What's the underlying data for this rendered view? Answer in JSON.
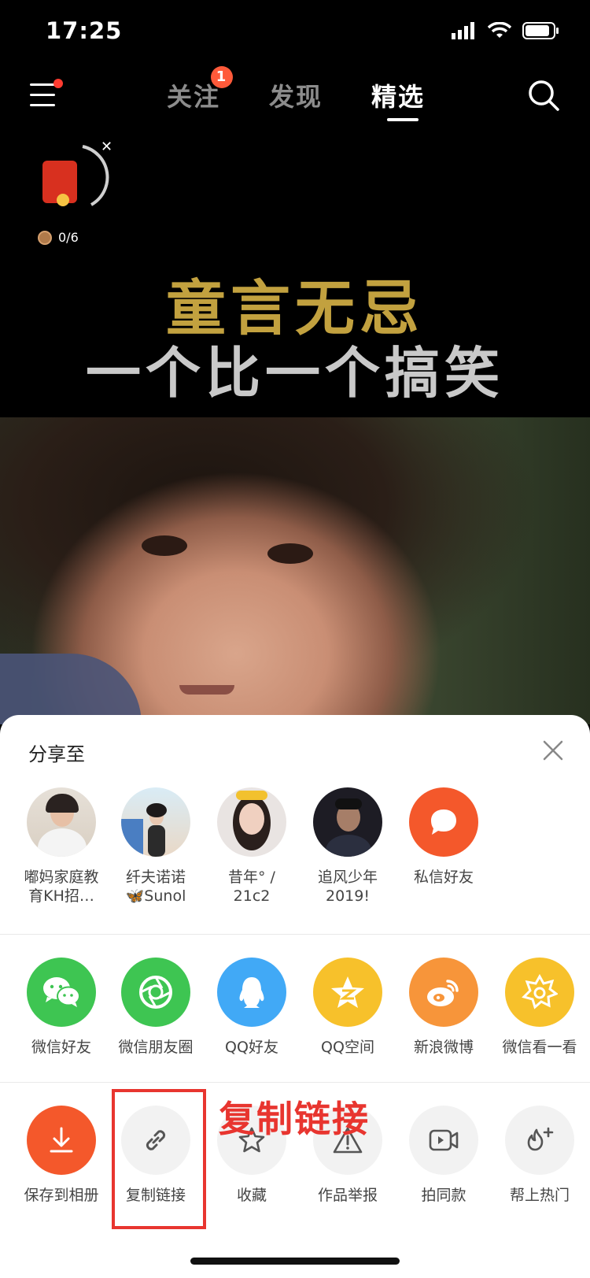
{
  "status_bar": {
    "time": "17:25"
  },
  "top_nav": {
    "tabs": [
      {
        "label": "关注",
        "badge": "1"
      },
      {
        "label": "发现"
      },
      {
        "label": "精选",
        "active": true
      }
    ]
  },
  "red_packet": {
    "progress_text": "0/6"
  },
  "video": {
    "caption_line1": "童言无忌",
    "caption_line2": "一个比一个搞笑"
  },
  "share_sheet": {
    "title": "分享至",
    "contacts": [
      {
        "name_line1": "嘟妈家庭教",
        "name_line2": "育KH招…"
      },
      {
        "name_line1": "纤夫诺诺",
        "name_line2": "🦋Sunol"
      },
      {
        "name_line1": "昔年° /",
        "name_line2": "21c2"
      },
      {
        "name_line1": "追风少年",
        "name_line2": "2019!"
      },
      {
        "name_line1": "私信好友",
        "name_line2": ""
      }
    ],
    "platforms": [
      {
        "label": "微信好友",
        "color": "#3ec552",
        "icon": "wechat-icon"
      },
      {
        "label": "微信朋友圈",
        "color": "#3ec552",
        "icon": "moments-icon"
      },
      {
        "label": "QQ好友",
        "color": "#41a9f6",
        "icon": "qq-icon"
      },
      {
        "label": "QQ空间",
        "color": "#f7c12b",
        "icon": "qzone-icon"
      },
      {
        "label": "新浪微博",
        "color": "#f7953a",
        "icon": "weibo-icon"
      },
      {
        "label": "微信看一看",
        "color": "#f7c12b",
        "icon": "wechat-look-icon"
      }
    ],
    "actions": [
      {
        "label": "保存到相册",
        "icon": "download-icon"
      },
      {
        "label": "复制链接",
        "icon": "link-icon"
      },
      {
        "label": "收藏",
        "icon": "star-icon"
      },
      {
        "label": "作品举报",
        "icon": "warning-icon"
      },
      {
        "label": "拍同款",
        "icon": "video-camera-icon"
      },
      {
        "label": "帮上热门",
        "icon": "fire-plus-icon"
      }
    ]
  },
  "annotation": {
    "text": "复制链接",
    "color": "#e8352f"
  }
}
